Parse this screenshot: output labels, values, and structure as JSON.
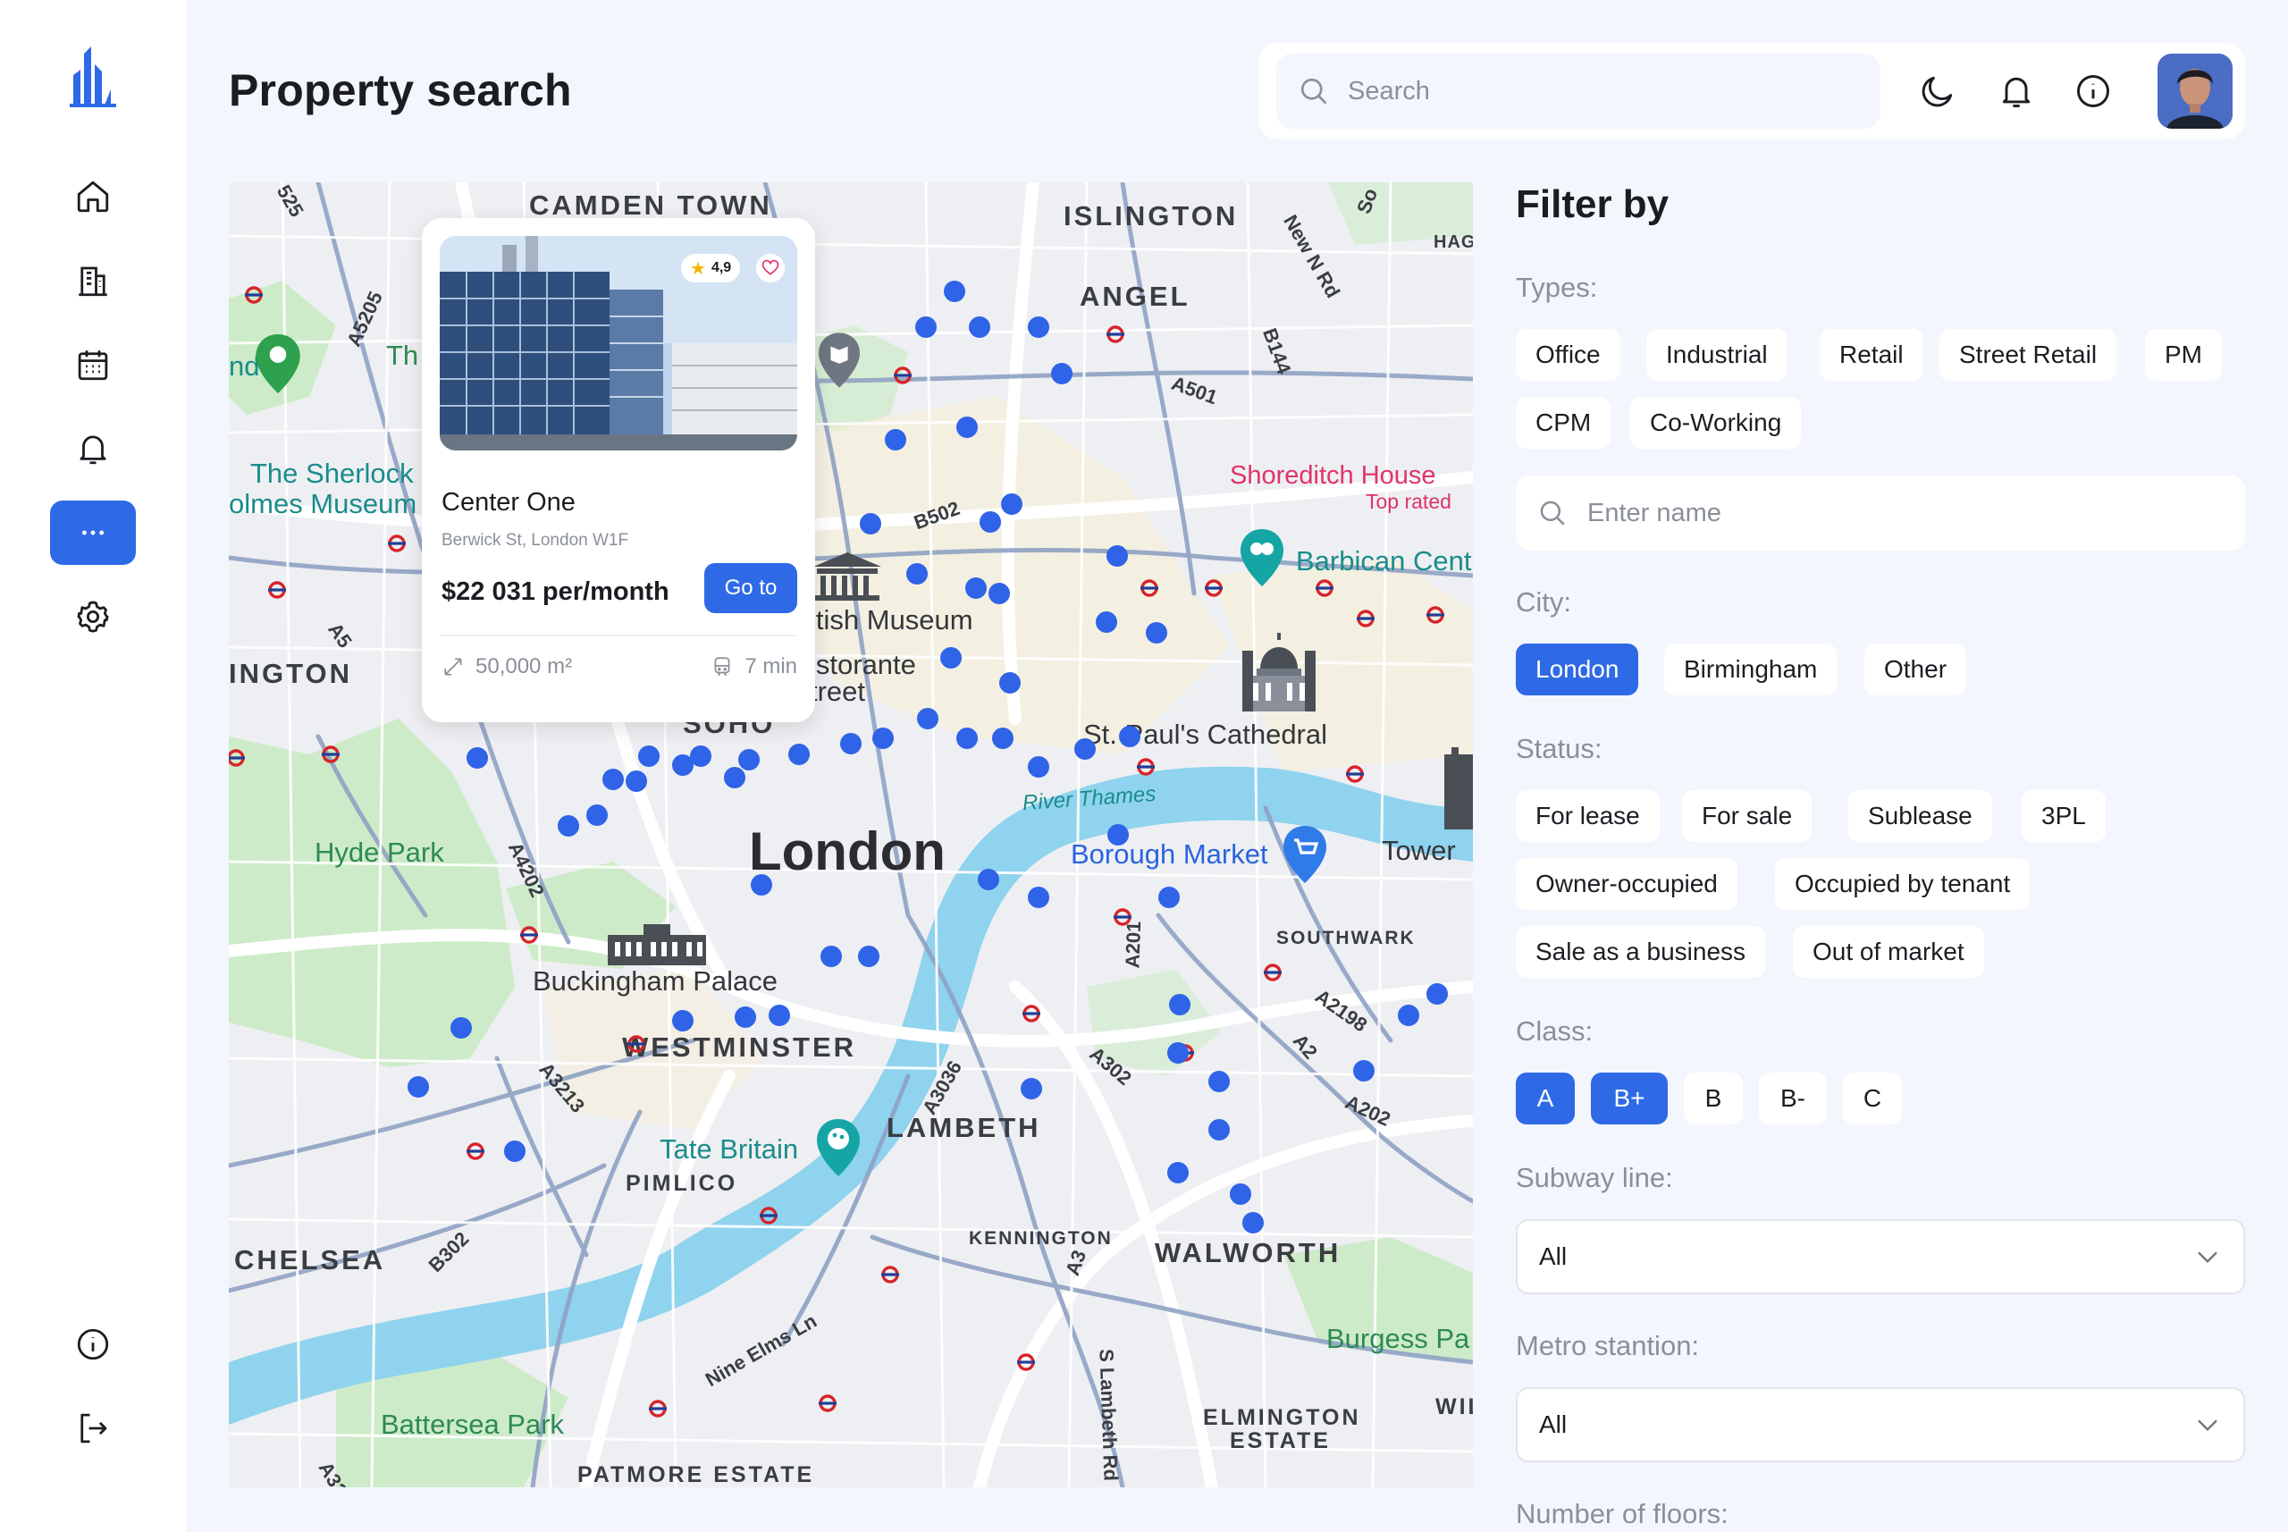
{
  "header": {
    "title": "Property search"
  },
  "search": {
    "placeholder": "Search"
  },
  "sidebar": {
    "items": [
      {
        "icon": "home-icon"
      },
      {
        "icon": "building-icon"
      },
      {
        "icon": "calendar-icon"
      },
      {
        "icon": "bell-icon"
      },
      {
        "icon": "more-icon",
        "active": true
      },
      {
        "icon": "gear-icon"
      },
      {
        "icon": "info-icon"
      },
      {
        "icon": "logout-icon"
      }
    ]
  },
  "map": {
    "labels": {
      "camden": "CAMDEN TOWN",
      "islington": "ISLINGTON",
      "angel": "ANGEL",
      "sherlock1": "The Sherlock",
      "sherlock2": "olmes Museum",
      "shoreditch": "Shoreditch House",
      "top_rated": "Top rated",
      "barbican": "Barbican Cent",
      "british": "itish Museum",
      "ristorante1": "istorante",
      "ristorante2": "treet",
      "stpauls": "St. Paul's Cathedral",
      "ington": "INGTON",
      "soho": "SOHO",
      "hyde": "Hyde Park",
      "london": "London",
      "river": "River Thames",
      "borough": "Borough Market",
      "tower": "Tower",
      "southwark": "SOUTHWARK",
      "buckingham": "Buckingham Palace",
      "westminster": "WESTMINSTER",
      "lambeth": "LAMBETH",
      "tate": "Tate Britain",
      "pimlico": "PIMLICO",
      "chelsea": "CHELSEA",
      "kennington": "KENNINGTON",
      "walworth": "WALWORTH",
      "burgess": "Burgess Pa",
      "battersea": "Battersea Park",
      "elmington1": "ELMINGTON",
      "elmington2": "ESTATE",
      "patmore": "PATMORE ESTATE",
      "wil": "WIL",
      "hag": "HAG",
      "th": "Th",
      "nd": "nd"
    },
    "roads": [
      "A5205",
      "A501",
      "B144",
      "New N Rd",
      "B502",
      "A5",
      "A4202",
      "A3213",
      "A3036",
      "A302",
      "A201",
      "A2198",
      "A2",
      "A202",
      "B302",
      "Nine Elms Ln",
      "S Lambeth Rd",
      "A3",
      "A32",
      "525",
      "So"
    ]
  },
  "card": {
    "rating": "4,9",
    "name": "Center One",
    "address": "Berwick St, London W1F",
    "price": "$22 031 per/month",
    "button": "Go to",
    "area": "50,000 m²",
    "time": "7 min"
  },
  "filters": {
    "title": "Filter by",
    "types_label": "Types:",
    "types": [
      "Office",
      "Industrial",
      "Retail",
      "Street Retail",
      "PM",
      "CPM",
      "Co-Working"
    ],
    "name_placeholder": "Enter name",
    "city_label": "City:",
    "cities": [
      "London",
      "Birmingham",
      "Other"
    ],
    "city_selected": "London",
    "status_label": "Status:",
    "statuses": [
      "For lease",
      "For sale",
      "Sublease",
      "3PL",
      "Owner-occupied",
      "Occupied by tenant",
      "Sale as a business",
      "Out of market"
    ],
    "class_label": "Class:",
    "classes": [
      "A",
      "B+",
      "B",
      "B-",
      "C"
    ],
    "class_selected": [
      "A",
      "B+"
    ],
    "subway_label": "Subway line:",
    "subway_value": "All",
    "metro_label": "Metro stantion:",
    "metro_value": "All",
    "floors_label": "Number of floors:"
  },
  "colors": {
    "accent": "#2E6AE6",
    "background": "#F3F6FD",
    "river": "#8FD3EE",
    "park": "#CDEBC8",
    "dot": "#2F63E8"
  }
}
